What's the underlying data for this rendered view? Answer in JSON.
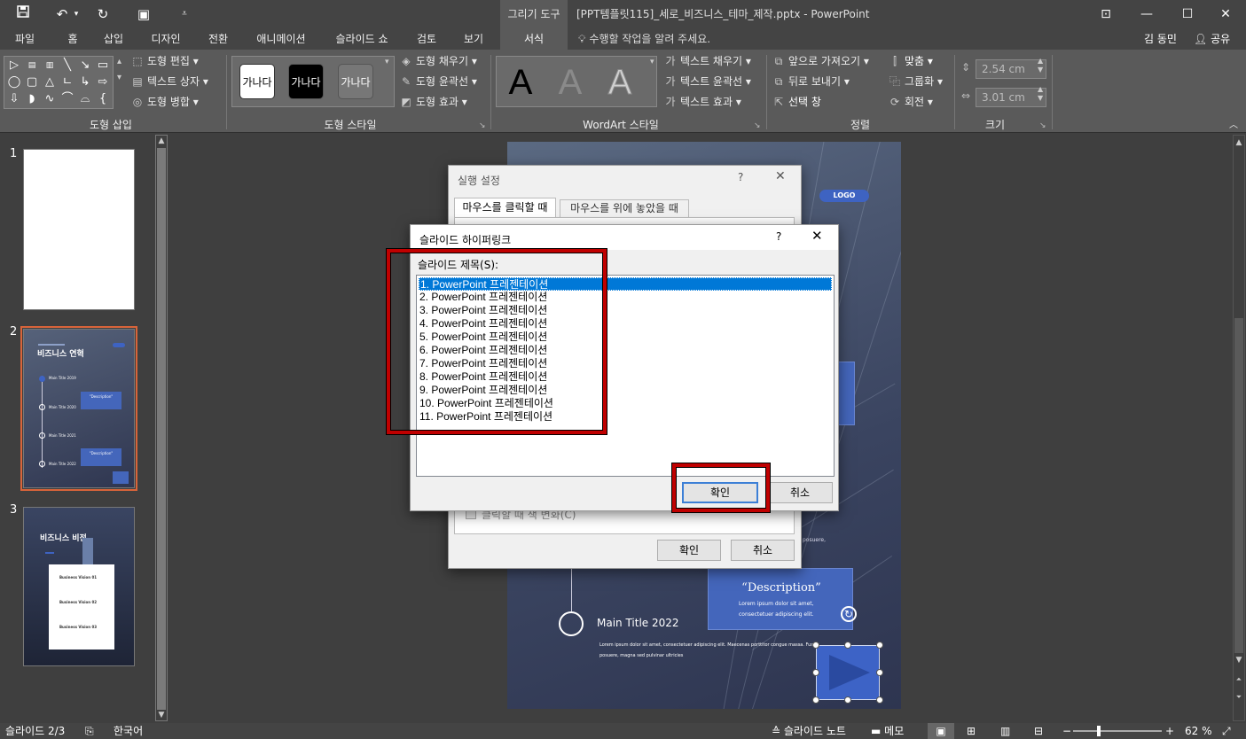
{
  "titlebar": {
    "context_group": "그리기 도구",
    "document_title": "[PPT템플릿115]_세로_비즈니스_테마_제작.pptx - PowerPoint"
  },
  "menu": {
    "tabs": [
      "파일",
      "홈",
      "삽입",
      "디자인",
      "전환",
      "애니메이션",
      "슬라이드 쇼",
      "검토",
      "보기",
      "서식"
    ],
    "active_tab": "서식",
    "tell_me": "수행할 작업을 알려 주세요.",
    "user": "김 동민",
    "share": "공유"
  },
  "ribbon": {
    "insert_shapes": {
      "label": "도형 삽입",
      "edit_shape": "도형 편집",
      "text_box": "텍스트 상자",
      "merge_shapes": "도형 병합"
    },
    "shape_styles": {
      "label": "도형 스타일",
      "swatch_text": "가나다",
      "fill": "도형 채우기",
      "outline": "도형 윤곽선",
      "effects": "도형 효과"
    },
    "wordart": {
      "label": "WordArt 스타일",
      "letter": "A",
      "text_fill": "텍스트 채우기",
      "text_outline": "텍스트 윤곽선",
      "text_effects": "텍스트 효과"
    },
    "arrange": {
      "label": "정렬",
      "bring_forward": "앞으로 가져오기",
      "send_backward": "뒤로 보내기",
      "selection_pane": "선택 창",
      "align": "맞춤",
      "group": "그룹화",
      "rotate": "회전"
    },
    "size": {
      "label": "크기",
      "height": "2.54 cm",
      "width": "3.01 cm"
    }
  },
  "slides_panel": {
    "slides": [
      {
        "number": "1"
      },
      {
        "number": "2",
        "title": "비즈니스 연혁",
        "items": [
          "Main Title 2019",
          "Main Title 2020",
          "Main Title 2021",
          "Main Title 2022"
        ],
        "desc": "\"Description\""
      },
      {
        "number": "3",
        "title": "비즈니스 비전",
        "items": [
          "Business Vision 01",
          "Business Vision 02",
          "Business Vision 03"
        ]
      }
    ],
    "selected": 2
  },
  "slide": {
    "logo": "LOGO",
    "description_title": "“Description”",
    "description_body": "Lorem ipsum dolor sit amet, consectetuer adipiscing elit.",
    "main_title": "Main Title 2022",
    "main_body": "Lorem ipsum dolor sit amet, consectetuer adipiscing elit. Maecenas porttitor congue massa. Fusce posuere, magna sed pulvinar ultricies",
    "partial_text": "posuere,"
  },
  "action_dialog": {
    "title": "실행 설정",
    "help": "?",
    "tabs": [
      "마우스를 클릭할 때",
      "마우스를 위에 놓았을 때"
    ],
    "checkbox_label": "클릭할 때 색 변화(C)",
    "ok": "확인",
    "cancel": "취소"
  },
  "hyperlink_dialog": {
    "title": "슬라이드 하이퍼링크",
    "help": "?",
    "list_label": "슬라이드 제목(S):",
    "items": [
      "1. PowerPoint 프레젠테이션",
      "2. PowerPoint 프레젠테이션",
      "3. PowerPoint 프레젠테이션",
      "4. PowerPoint 프레젠테이션",
      "5. PowerPoint 프레젠테이션",
      "6. PowerPoint 프레젠테이션",
      "7. PowerPoint 프레젠테이션",
      "8. PowerPoint 프레젠테이션",
      "9. PowerPoint 프레젠테이션",
      "10. PowerPoint 프레젠테이션",
      "11. PowerPoint 프레젠테이션"
    ],
    "selected_index": 0,
    "ok": "확인",
    "cancel": "취소"
  },
  "statusbar": {
    "slide_info": "슬라이드 2/3",
    "language": "한국어",
    "notes": "슬라이드 노트",
    "comments": "메모",
    "zoom": "62 %",
    "zoom_level": 0.62
  },
  "colors": {
    "highlight_red": "#c00000",
    "selection_blue": "#0078d7",
    "thumb_selected": "#d9643a"
  }
}
